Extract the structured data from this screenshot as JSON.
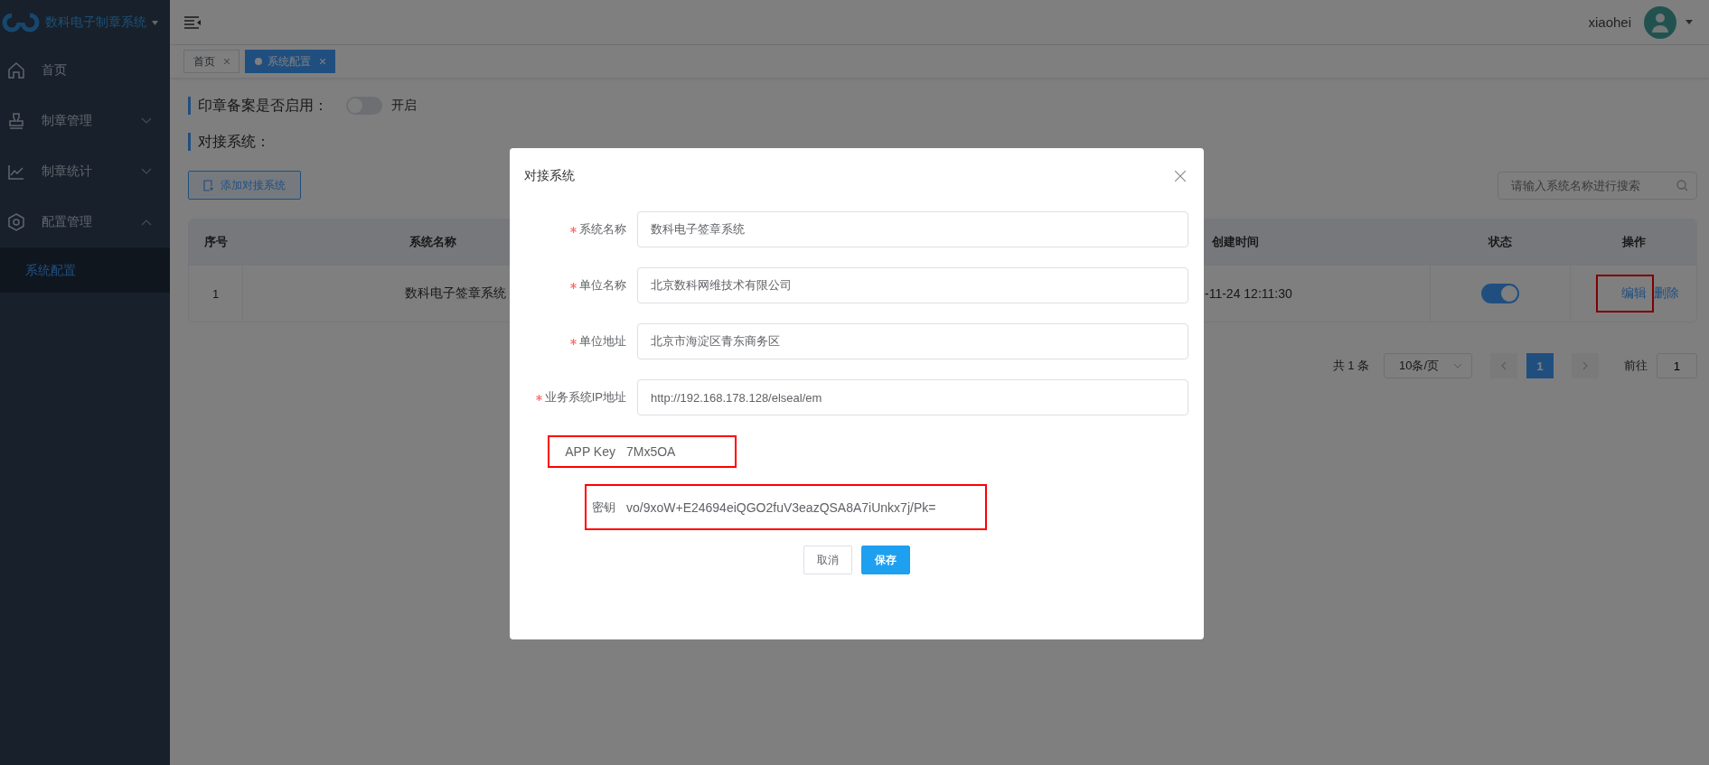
{
  "sidebar": {
    "brand": "数科电子制章系统",
    "items": [
      {
        "label": "首页",
        "selected": false
      },
      {
        "label": "制章管理",
        "selected": false,
        "expanded": false
      },
      {
        "label": "制章统计",
        "selected": false,
        "expanded": false
      },
      {
        "label": "配置管理",
        "selected": false,
        "expanded": true,
        "children": [
          {
            "label": "系统配置",
            "selected": true
          }
        ]
      }
    ]
  },
  "header": {
    "user": "xiaohei"
  },
  "tabs": [
    {
      "label": "首页",
      "selected": false
    },
    {
      "label": "系统配置",
      "selected": true
    }
  ],
  "settings": {
    "filing_label": "印章备案是否启用：",
    "filing_on": false,
    "filing_text": "开启",
    "section_title": "对接系统：",
    "add_button": "添加对接系统",
    "search": {
      "placeholder": "请输入系统名称进行搜索"
    }
  },
  "table": {
    "columns": [
      "序号",
      "系统名称",
      "创建时间",
      "状态",
      "操作"
    ],
    "rows": [
      {
        "cells": [
          "1",
          "数科电子签章系统",
          "-11-24 12:11:30"
        ],
        "status_on": true,
        "actions": [
          {
            "label": "编辑",
            "highlighted": true
          },
          {
            "label": "删除",
            "highlighted": false
          }
        ]
      }
    ]
  },
  "pagination": {
    "total": "共 1 条",
    "page_size": "10条/页",
    "pages": [
      {
        "label": "1",
        "selected": true
      }
    ],
    "goto_label": "前往",
    "goto_value": "1"
  },
  "dialog": {
    "title": "对接系统",
    "fields": [
      {
        "label": "系统名称",
        "required": true,
        "value": "数科电子签章系统"
      },
      {
        "label": "单位名称",
        "required": true,
        "value": "北京数科网维技术有限公司"
      },
      {
        "label": "单位地址",
        "required": true,
        "value": "北京市海淀区青东商务区"
      },
      {
        "label": "业务系统IP地址",
        "required": true,
        "value": "http://192.168.178.128/elseal/em"
      }
    ],
    "info": [
      {
        "label": "APP Key",
        "value": "7Mx5OA",
        "highlighted": true
      },
      {
        "label": "密钥",
        "value": "vo/9xoW+E24694eiQGO2fuV3eazQSA8A7iUnkx7j/Pk=",
        "highlighted": true
      }
    ],
    "buttons": [
      "取消",
      "保存"
    ]
  }
}
